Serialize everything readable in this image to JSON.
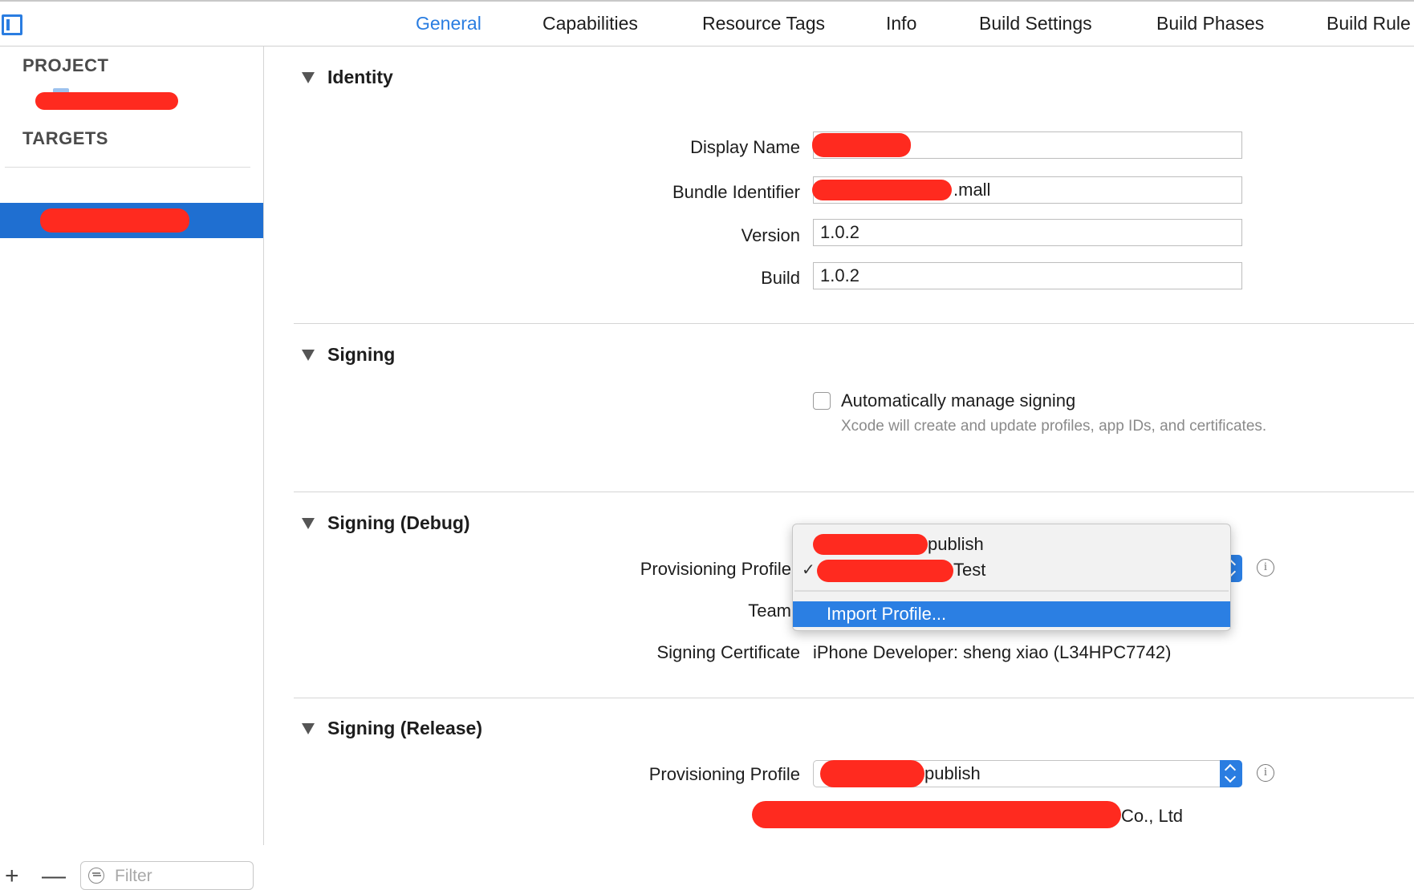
{
  "colors": {
    "accent": "#2a7de1",
    "selection": "#1f6fd1",
    "redaction": "#ff2a1f"
  },
  "tabs": [
    {
      "label": "General",
      "active": true
    },
    {
      "label": "Capabilities"
    },
    {
      "label": "Resource Tags"
    },
    {
      "label": "Info"
    },
    {
      "label": "Build Settings"
    },
    {
      "label": "Build Phases"
    },
    {
      "label": "Build Rule"
    }
  ],
  "sidebar": {
    "project_heading": "PROJECT",
    "targets_heading": "TARGETS",
    "filter_placeholder": "Filter",
    "add_label": "+",
    "remove_label": "—"
  },
  "identity": {
    "title": "Identity",
    "display_name_label": "Display Name",
    "bundle_identifier_label": "Bundle Identifier",
    "bundle_identifier_suffix": ".mall",
    "version_label": "Version",
    "version_value": "1.0.2",
    "build_label": "Build",
    "build_value": "1.0.2"
  },
  "signing": {
    "title": "Signing",
    "auto_manage_label": "Automatically manage signing",
    "auto_manage_checked": false,
    "auto_manage_description": "Xcode will create and update profiles, app IDs, and certificates."
  },
  "signing_debug": {
    "title": "Signing (Debug)",
    "provisioning_profile_label": "Provisioning Profile",
    "team_label": "Team",
    "signing_certificate_label": "Signing Certificate",
    "signing_certificate_value": "iPhone Developer: sheng xiao (L34HPC7742)",
    "menu": {
      "items": [
        {
          "suffix": "publish",
          "checked": false
        },
        {
          "suffix": "Test",
          "checked": true
        }
      ],
      "check_glyph": "✓",
      "import_label": "Import Profile..."
    }
  },
  "signing_release": {
    "title": "Signing (Release)",
    "provisioning_profile_label": "Provisioning Profile",
    "provisioning_profile_suffix": "publish",
    "team_suffix": "Co., Ltd"
  }
}
